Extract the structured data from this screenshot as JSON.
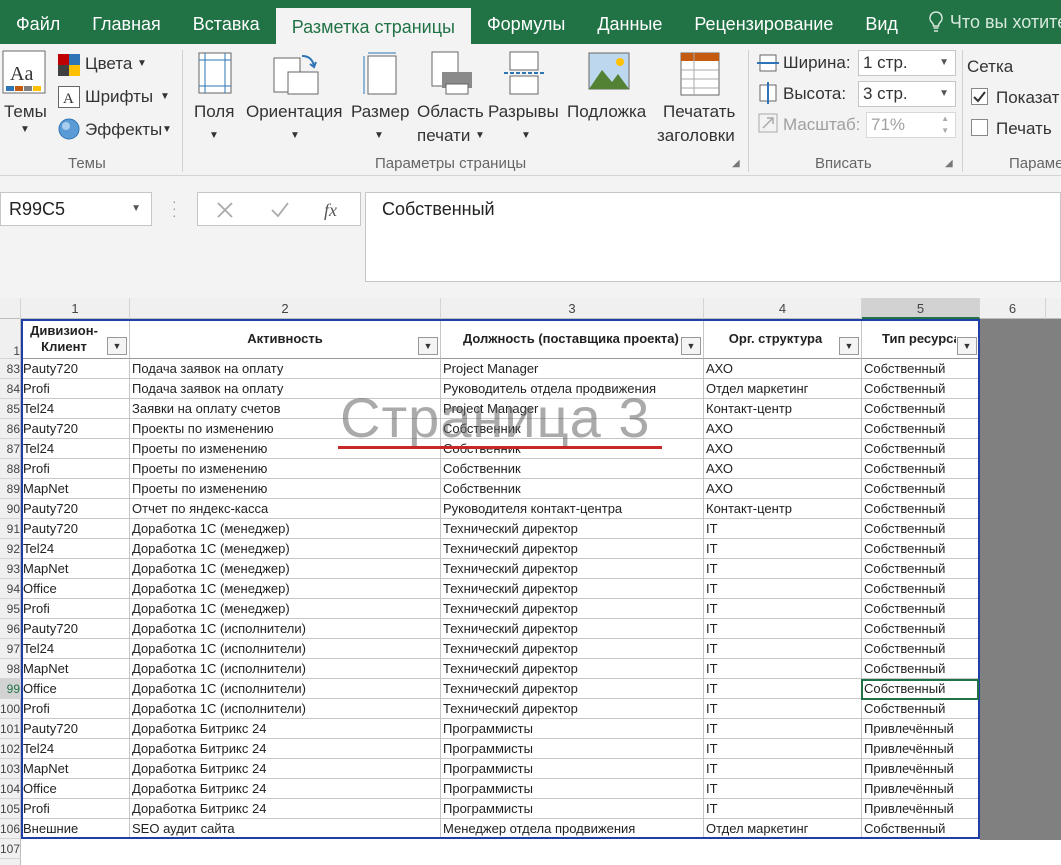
{
  "ribbon_tabs": [
    "Файл",
    "Главная",
    "Вставка",
    "Разметка страницы",
    "Формулы",
    "Данные",
    "Рецензирование",
    "Вид"
  ],
  "active_tab_index": 3,
  "tell_me": "Что вы хотите сде",
  "themes_group": {
    "themes_label": "Темы",
    "colors_label": "Цвета",
    "fonts_label": "Шрифты",
    "effects_label": "Эффекты",
    "group_label": "Темы"
  },
  "page_setup_group": {
    "margins_label": "Поля",
    "orientation_label": "Ориентация",
    "size_label": "Размер",
    "print_area_line1": "Область",
    "print_area_line2": "печати",
    "breaks_label": "Разрывы",
    "background_label": "Подложка",
    "print_titles_line1": "Печатать",
    "print_titles_line2": "заголовки",
    "group_label": "Параметры страницы"
  },
  "scale_group": {
    "width_label": "Ширина:",
    "width_value": "1 стр.",
    "height_label": "Высота:",
    "height_value": "3 стр.",
    "scale_label": "Масштаб:",
    "scale_value": "71%",
    "group_label": "Вписать"
  },
  "sheet_options_group": {
    "gridlines_label": "Сетка",
    "show_label": "Показат",
    "print_label": "Печать",
    "group_label": "Параме"
  },
  "name_box": "R99C5",
  "formula_text": "Собственный",
  "column_headers": [
    "1",
    "2",
    "3",
    "4",
    "5",
    "6"
  ],
  "header_row_number": "1",
  "table_headers": [
    "Дивизион-Клиент",
    "Активность",
    "Должность (поставщика проекта)",
    "Орг. структура",
    "Тип ресурса"
  ],
  "page_watermark": "Страница 3",
  "rows": [
    {
      "n": "83",
      "c": [
        "Pauty720",
        "Подача заявок на оплату",
        "Project Manager",
        "АХО",
        "Собственный"
      ]
    },
    {
      "n": "84",
      "c": [
        "Profi",
        "Подача заявок на оплату",
        "Руководитель отдела продвижения",
        "Отдел маркетинг",
        "Собственный"
      ]
    },
    {
      "n": "85",
      "c": [
        "Tel24",
        "Заявки на оплату счетов",
        "Project Manager",
        "Контакт-центр",
        "Собственный"
      ]
    },
    {
      "n": "86",
      "c": [
        "Pauty720",
        "Проекты по изменению",
        "Собственник",
        "АХО",
        "Собственный"
      ]
    },
    {
      "n": "87",
      "c": [
        "Tel24",
        "Проеты по изменению",
        "Собственник",
        "АХО",
        "Собственный"
      ]
    },
    {
      "n": "88",
      "c": [
        "Profi",
        "Проеты по изменению",
        "Собственник",
        "АХО",
        "Собственный"
      ]
    },
    {
      "n": "89",
      "c": [
        "MapNet",
        "Проеты по изменению",
        "Собственник",
        "АХО",
        "Собственный"
      ]
    },
    {
      "n": "90",
      "c": [
        "Pauty720",
        "Отчет по яндекс-касса",
        "Руководителя контакт-центра",
        "Контакт-центр",
        "Собственный"
      ]
    },
    {
      "n": "91",
      "c": [
        "Pauty720",
        "Доработка 1С (менеджер)",
        "Технический директор",
        "IT",
        "Собственный"
      ]
    },
    {
      "n": "92",
      "c": [
        "Tel24",
        "Доработка 1С (менеджер)",
        "Технический директор",
        "IT",
        "Собственный"
      ]
    },
    {
      "n": "93",
      "c": [
        "MapNet",
        "Доработка 1С (менеджер)",
        "Технический директор",
        "IT",
        "Собственный"
      ]
    },
    {
      "n": "94",
      "c": [
        "Office",
        "Доработка 1С (менеджер)",
        "Технический директор",
        "IT",
        "Собственный"
      ]
    },
    {
      "n": "95",
      "c": [
        "Profi",
        "Доработка 1С (менеджер)",
        "Технический директор",
        "IT",
        "Собственный"
      ]
    },
    {
      "n": "96",
      "c": [
        "Pauty720",
        "Доработка 1С (исполнители)",
        "Технический директор",
        "IT",
        "Собственный"
      ]
    },
    {
      "n": "97",
      "c": [
        "Tel24",
        "Доработка 1С (исполнители)",
        "Технический директор",
        "IT",
        "Собственный"
      ]
    },
    {
      "n": "98",
      "c": [
        "MapNet",
        "Доработка 1С (исполнители)",
        "Технический директор",
        "IT",
        "Собственный"
      ]
    },
    {
      "n": "99",
      "c": [
        "Office",
        "Доработка 1С (исполнители)",
        "Технический директор",
        "IT",
        "Собственный"
      ]
    },
    {
      "n": "100",
      "c": [
        "Profi",
        "Доработка 1С (исполнители)",
        "Технический директор",
        "IT",
        "Собственный"
      ]
    },
    {
      "n": "101",
      "c": [
        "Pauty720",
        "Доработка Битрикс 24",
        "Программисты",
        "IT",
        "Привлечённый"
      ]
    },
    {
      "n": "102",
      "c": [
        "Tel24",
        "Доработка Битрикс 24",
        "Программисты",
        "IT",
        "Привлечённый"
      ]
    },
    {
      "n": "103",
      "c": [
        "MapNet",
        "Доработка Битрикс 24",
        "Программисты",
        "IT",
        "Привлечённый"
      ]
    },
    {
      "n": "104",
      "c": [
        "Office",
        "Доработка Битрикс 24",
        "Программисты",
        "IT",
        "Привлечённый"
      ]
    },
    {
      "n": "105",
      "c": [
        "Profi",
        "Доработка Битрикс 24",
        "Программисты",
        "IT",
        "Привлечённый"
      ]
    },
    {
      "n": "106",
      "c": [
        "Внешние",
        "SEO аудит сайта",
        "Менеджер отдела продвижения",
        "Отдел маркетинг",
        "Собственный"
      ]
    }
  ],
  "last_row_number": "107",
  "colors": {
    "excel_green": "#217346",
    "page_border": "#1f3fa6",
    "watermark_underline": "#c62828"
  }
}
